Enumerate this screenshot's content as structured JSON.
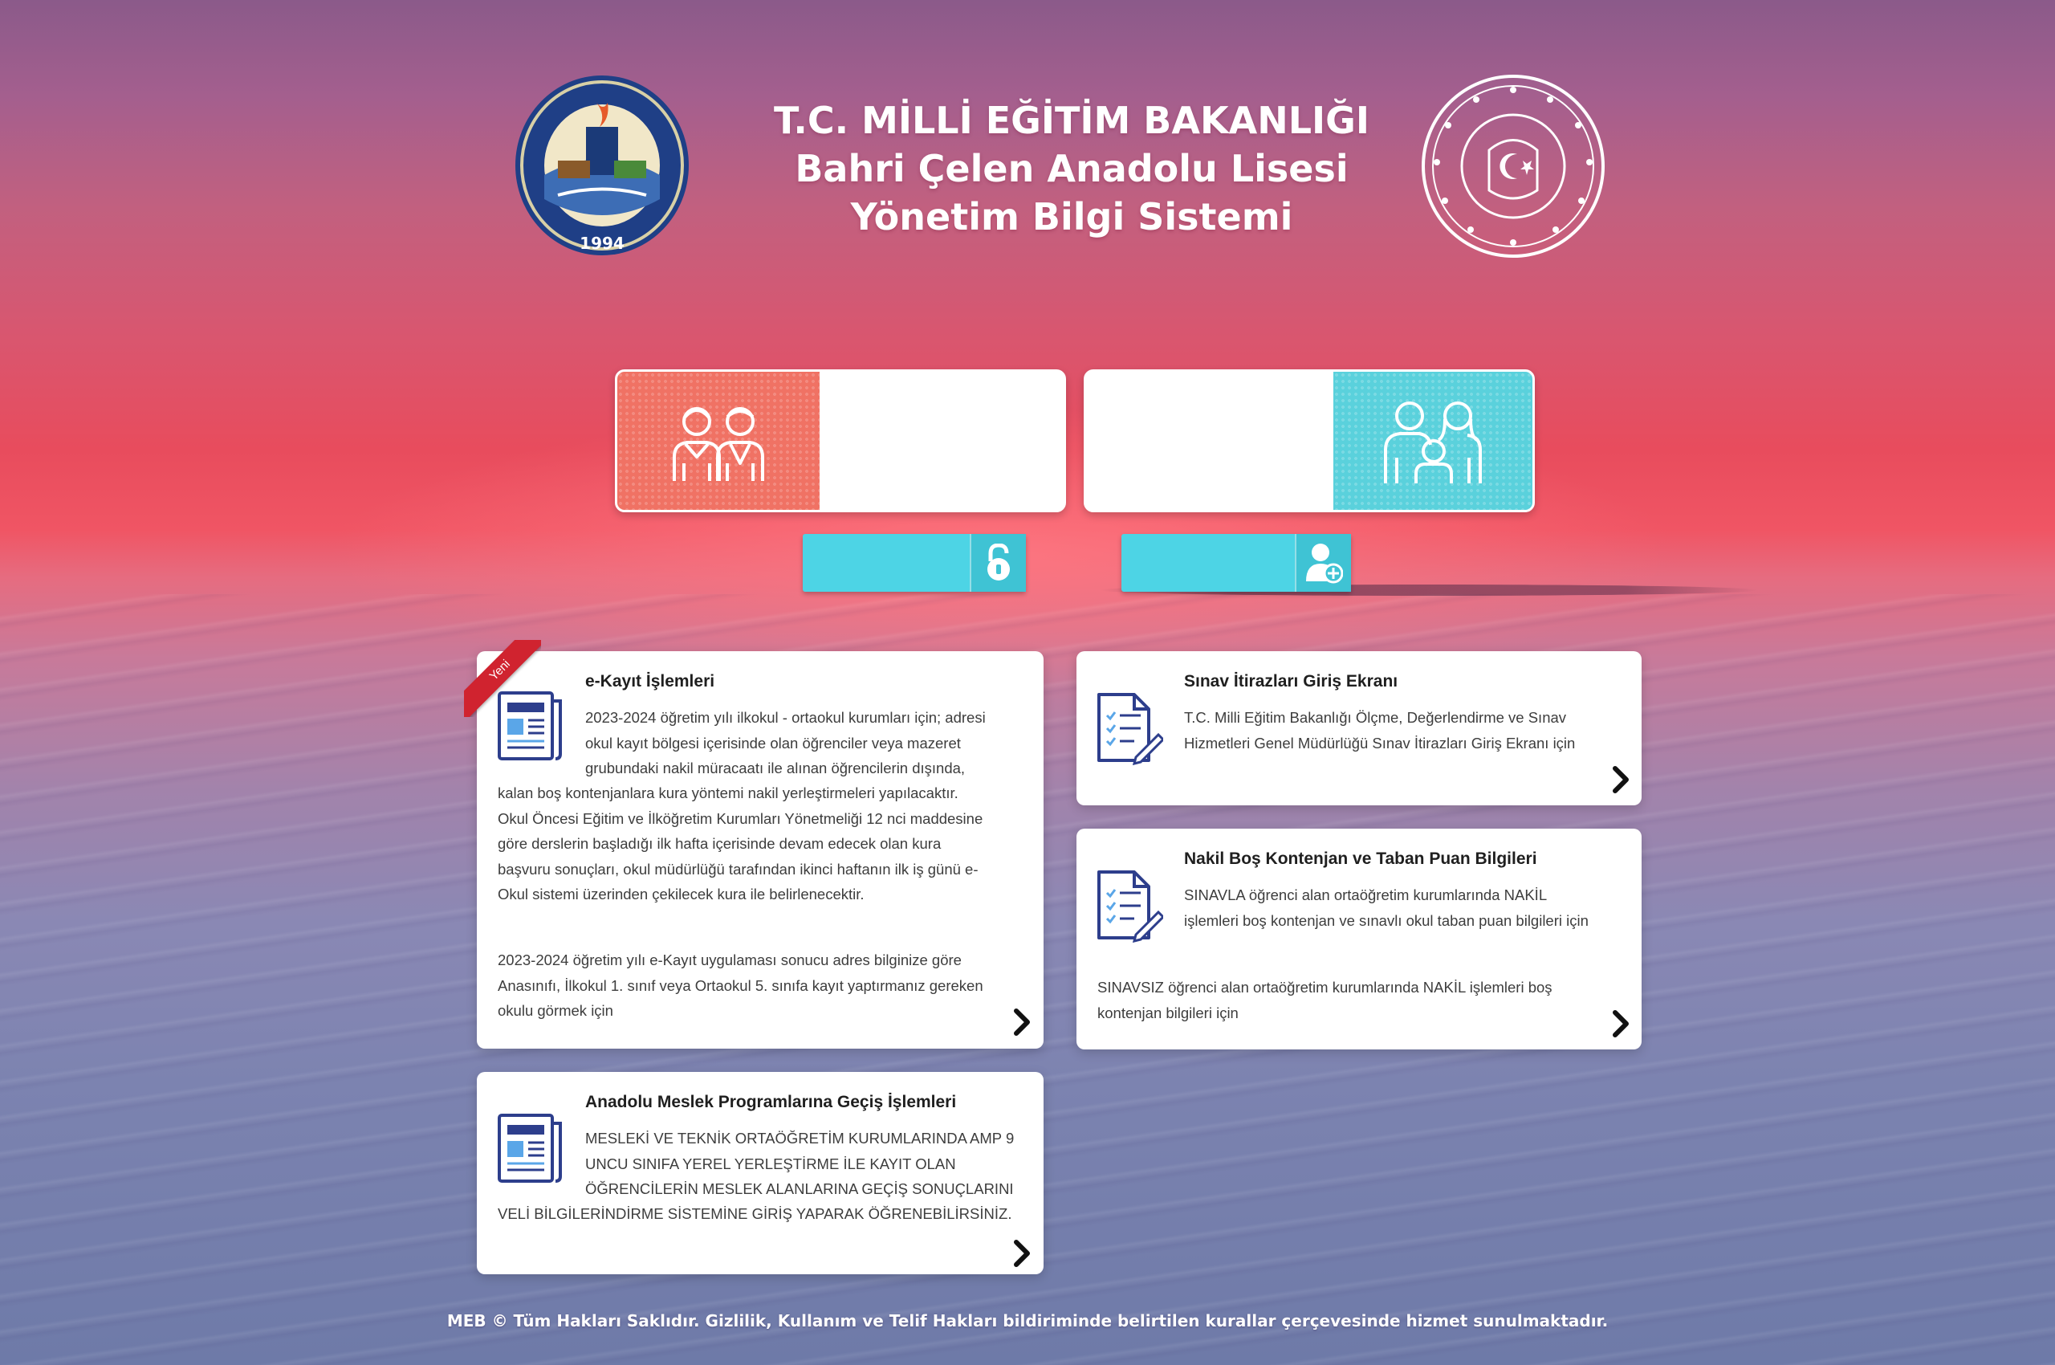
{
  "header": {
    "title_line1": "T.C. MİLLİ EĞİTİM BAKANLIĞI",
    "title_line2": "Bahri Çelen Anadolu Lisesi",
    "title_line3": "Yönetim Bilgi Sistemi",
    "school_logo": {
      "icon": "school-emblem",
      "year": "1994"
    },
    "ministry_logo": {
      "icon": "meb-seal"
    }
  },
  "login": {
    "student_card": {
      "icon": "students-icon",
      "label": ""
    },
    "parent_card": {
      "icon": "family-icon",
      "label": ""
    },
    "login_button": {
      "label": "",
      "icon": "unlock-icon"
    },
    "register_button": {
      "label": "",
      "icon": "add-user-icon"
    }
  },
  "panels": {
    "ekayit": {
      "badge": "Yeni",
      "title": "e-Kayıt İşlemleri",
      "lines_intro": [
        "2023-2024 öğretim yılı ilkokul - ortaokul kurumları için; adresi",
        "okul kayıt bölgesi içerisinde olan öğrenciler veya mazeret",
        "grubundaki nakil müracaatı ile alınan öğrencilerin dışında,"
      ],
      "lines_body": [
        "kalan boş kontenjanlara kura yöntemi nakil yerleştirmeleri yapılacaktır.",
        "Okul Öncesi Eğitim ve İlköğretim Kurumları Yönetmeliği 12 nci maddesine",
        "göre derslerin başladığı ilk hafta içerisinde devam edecek olan kura",
        "başvuru sonuçları, okul müdürlüğü tarafından ikinci haftanın ilk iş günü e-",
        "Okul sistemi üzerinden çekilecek kura ile belirlenecektir."
      ],
      "lines_second": [
        "2023-2024 öğretim yılı e-Kayıt uygulaması sonucu adres bilginize göre",
        "Anasınıfı, İlkokul 1. sınıf veya Ortaokul 5. sınıfa kayıt yaptırmanız gereken",
        "okulu görmek için"
      ]
    },
    "sinav": {
      "title": "Sınav İtirazları Giriş Ekranı",
      "lines": [
        "T.C. Milli Eğitim Bakanlığı Ölçme, Değerlendirme ve Sınav",
        "Hizmetleri Genel Müdürlüğü Sınav İtirazları Giriş Ekranı için"
      ]
    },
    "nakil": {
      "title": "Nakil Boş Kontenjan ve Taban Puan Bilgileri",
      "lines_intro": [
        "SINAVLA öğrenci alan ortaöğretim kurumlarında NAKİL",
        "işlemleri boş kontenjan ve sınavlı okul taban puan bilgileri için"
      ],
      "lines_second": [
        "SINAVSIZ öğrenci alan ortaöğretim kurumlarında NAKİL işlemleri boş",
        "kontenjan bilgileri için"
      ]
    },
    "amp": {
      "title": "Anadolu Meslek Programlarına Geçiş İşlemleri",
      "lines_intro": [
        "MESLEKİ VE TEKNİK ORTAÖĞRETİM KURUMLARINDA AMP 9",
        "UNCU SINIFA YEREL YERLEŞTİRME İLE KAYIT OLAN",
        "ÖĞRENCİLERİN MESLEK ALANLARINA GEÇİŞ SONUÇLARINI"
      ],
      "lines_body": [
        "VELİ BİLGİLERİNDİRME SİSTEMİNE GİRİŞ YAPARAK ÖĞRENEBİLİRSİNİZ."
      ]
    }
  },
  "footer": {
    "text": "MEB © Tüm Hakları Saklıdır. Gizlilik, Kullanım ve Telif Hakları bildiriminde belirtilen kurallar çerçevesinde hizmet sunulmaktadır."
  },
  "colors": {
    "student_tile": "#f07264",
    "parent_tile": "#5ad1dc",
    "button": "#4dd4e5",
    "icon_blue": "#2d3e8c",
    "ribbon": "#d0232f"
  }
}
